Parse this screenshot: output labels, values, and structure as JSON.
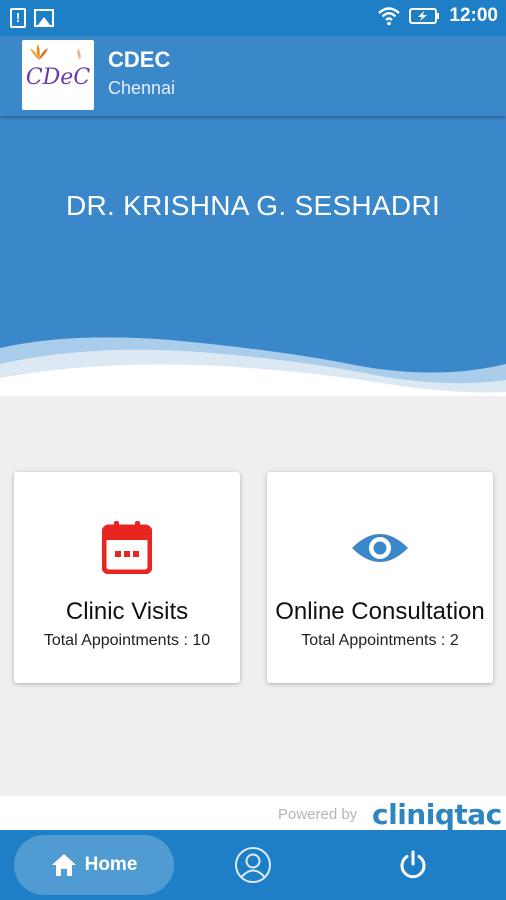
{
  "status_bar": {
    "time": "12:00",
    "icons": [
      "alert-icon",
      "image-icon",
      "wifi-icon",
      "battery-charging-icon"
    ]
  },
  "app_bar": {
    "title": "CDEC",
    "subtitle": "Chennai",
    "logo_text": "CDeC"
  },
  "hero": {
    "doctor_name": "DR. KRISHNA G. SESHADRI"
  },
  "cards": [
    {
      "title": "Clinic Visits",
      "count_text": "Total Appointments : 10",
      "icon": "calendar-icon",
      "icon_color": "#e8261f"
    },
    {
      "title": "Online Consultation",
      "count_text": "Total Appointments : 2",
      "icon": "eye-icon",
      "icon_color": "#3a87c9"
    }
  ],
  "footer": {
    "powered_by": "Powered by",
    "brand": "cliniqtac"
  },
  "bottom_nav": {
    "home_label": "Home",
    "items": [
      "home-icon",
      "profile-icon",
      "power-icon"
    ]
  },
  "colors": {
    "primary": "#3a87c9",
    "status_bar": "#1f7fc6",
    "background": "#efefef"
  }
}
